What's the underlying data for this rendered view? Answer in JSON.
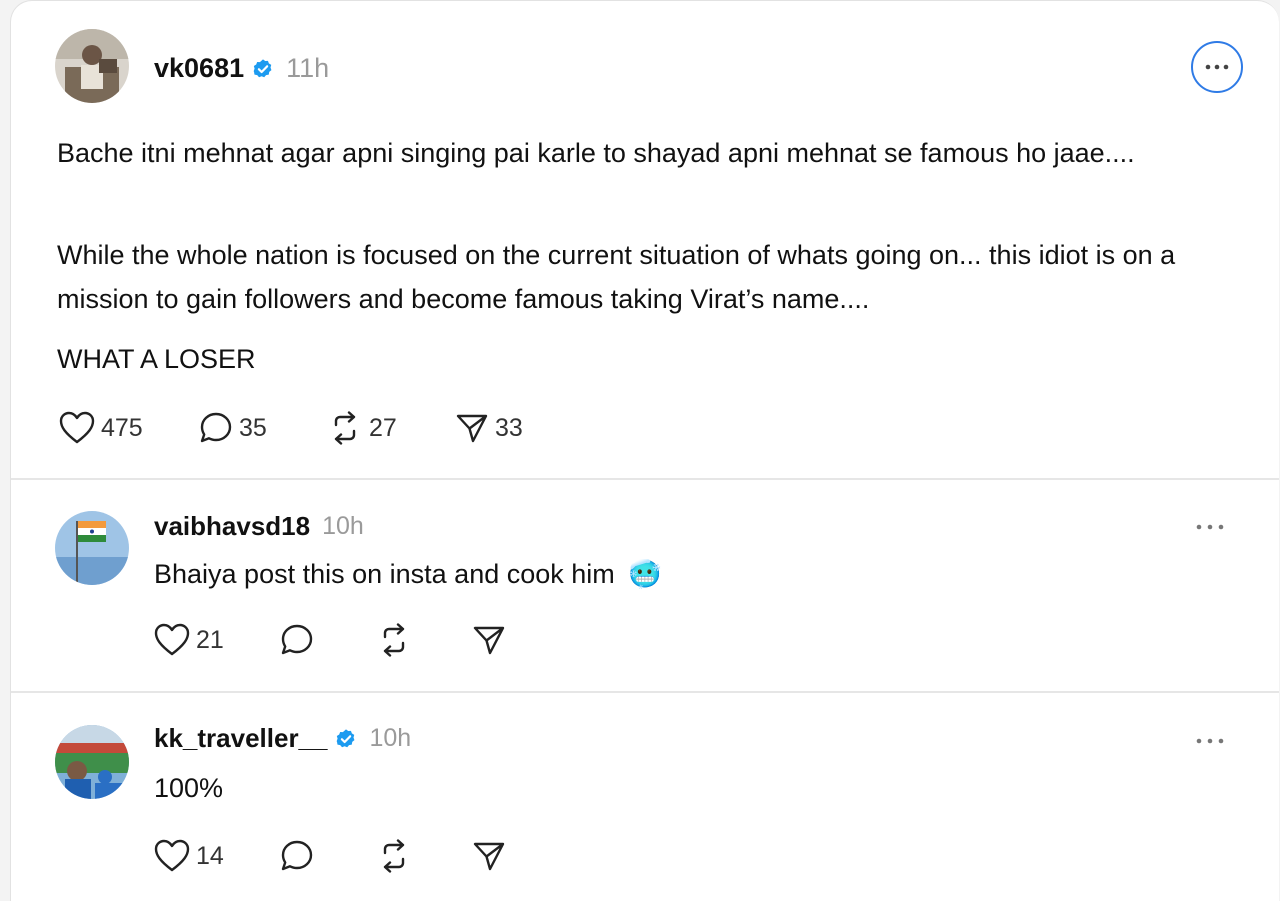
{
  "main_post": {
    "username": "vk0681",
    "time": "11h",
    "paragraphs": [
      "Bache itni mehnat agar apni singing pai karle to shayad apni mehnat se famous ho jaae....",
      "While the whole nation is focused on the current situation of whats going on... this idiot is on a mission to gain followers and become famous taking Virat’s name....",
      "WHAT A LOSER"
    ],
    "likes": "475",
    "replies": "35",
    "reposts": "27",
    "shares": "33"
  },
  "replies": [
    {
      "username": "vaibhavsd18",
      "time": "10h",
      "text": "Bhaiya post this on insta and cook him",
      "emoji": "🥶",
      "likes": "21"
    },
    {
      "username": "kk_traveller__",
      "time": "10h",
      "text": "100%",
      "likes": "14"
    }
  ],
  "colors": {
    "verified": "#1d9bf0",
    "more_border": "#2f7be6",
    "time": "#9a9a9a"
  },
  "icons": [
    "heart-icon",
    "reply-icon",
    "repost-icon",
    "share-icon",
    "verified-badge-icon",
    "more-icon"
  ]
}
